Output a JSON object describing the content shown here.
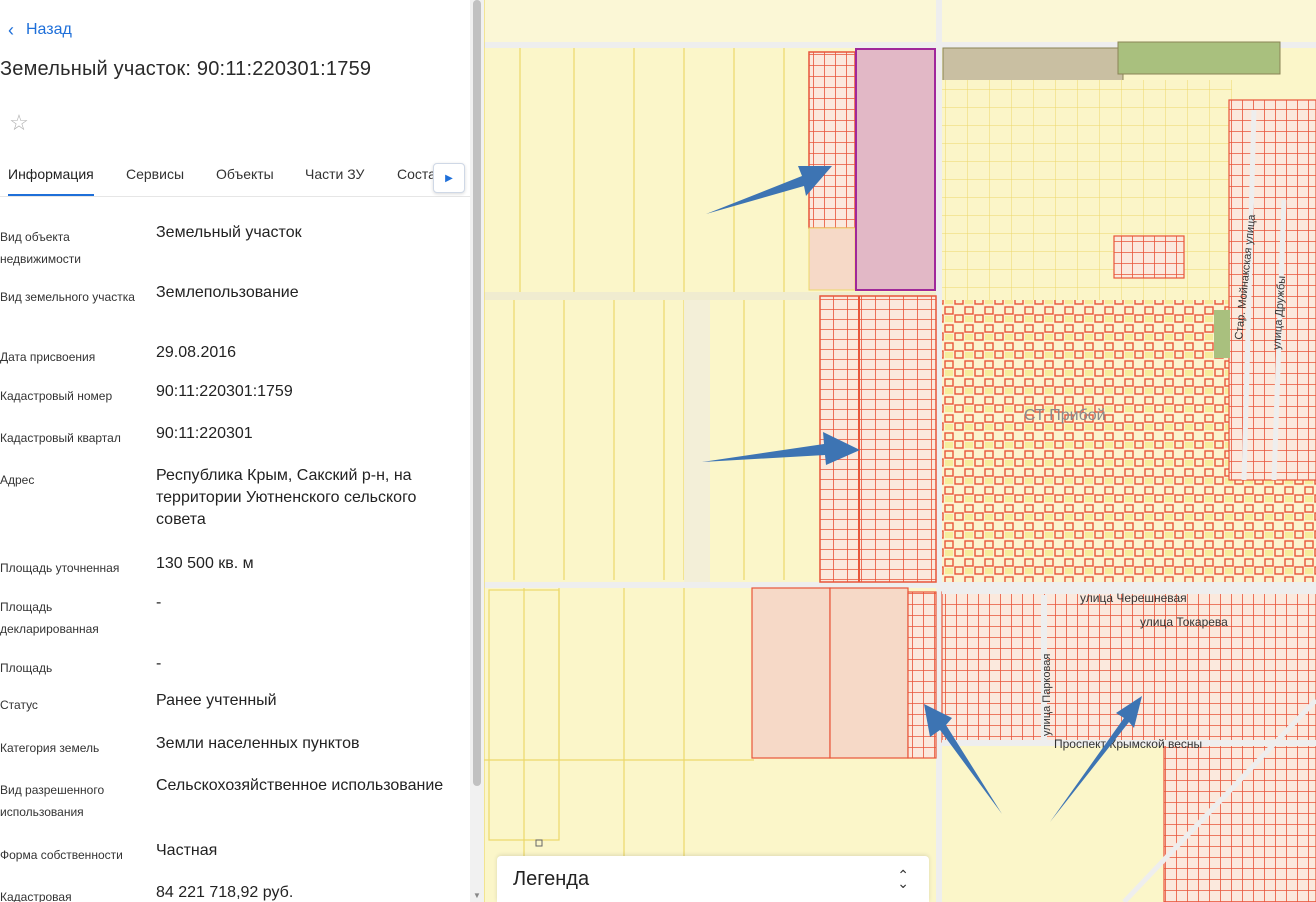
{
  "panel": {
    "back_label": "Назад",
    "title": "Земельный участок: 90:11:220301:1759",
    "tabs": [
      {
        "label": "Информация",
        "active": true
      },
      {
        "label": "Сервисы"
      },
      {
        "label": "Объекты"
      },
      {
        "label": "Части ЗУ"
      },
      {
        "label": "Соста"
      }
    ],
    "fields": [
      {
        "label": "Вид объекта недвижимости",
        "value": "Земельный участок"
      },
      {
        "label": "Вид земельного участка",
        "value": "Землепользование"
      },
      {
        "label": "Дата присвоения",
        "value": "29.08.2016"
      },
      {
        "label": "Кадастровый номер",
        "value": "90:11:220301:1759"
      },
      {
        "label": "Кадастровый квартал",
        "value": "90:11:220301"
      },
      {
        "label": "Адрес",
        "value": "Республика Крым, Сакский р-н, на территории Уютненского сельского совета"
      },
      {
        "label": "Площадь уточненная",
        "value": "130 500 кв. м"
      },
      {
        "label": "Площадь декларированная",
        "value": "-"
      },
      {
        "label": "Площадь",
        "value": "-"
      },
      {
        "label": "Статус",
        "value": "Ранее учтенный"
      },
      {
        "label": "Категория земель",
        "value": "Земли населенных пунктов"
      },
      {
        "label": "Вид разрешенного использования",
        "value": "Сельскохозяйственное использование"
      },
      {
        "label": "Форма собственности",
        "value": "Частная"
      },
      {
        "label": "Кадастровая",
        "value": "84 221 718,92 руб."
      }
    ]
  },
  "map": {
    "labels": {
      "settlement": "СТ Прибой",
      "street_chereshnevaya": "улица Черешневая",
      "street_tokareva": "улица Токарева",
      "street_parkovaya": "улица Парковая",
      "prospect": "Проспект Крымской весны",
      "street_moynakskaya": "Стар. Мойнакская улица",
      "street_druzhby": "улица Дружбы"
    },
    "colors": {
      "base": "#fbf6c9",
      "parcel_stroke": "#ecd86a",
      "parcel_red": "#e8553a",
      "parcel_pink_fill": "#f6d9c7",
      "selected_fill": "#e2b8c6",
      "selected_stroke": "#a0289a",
      "arrow": "#3d74b3",
      "gray_parcel": "#c9bfa2",
      "green_parcel": "#a9c07e"
    }
  },
  "legend": {
    "label": "Легенда"
  }
}
